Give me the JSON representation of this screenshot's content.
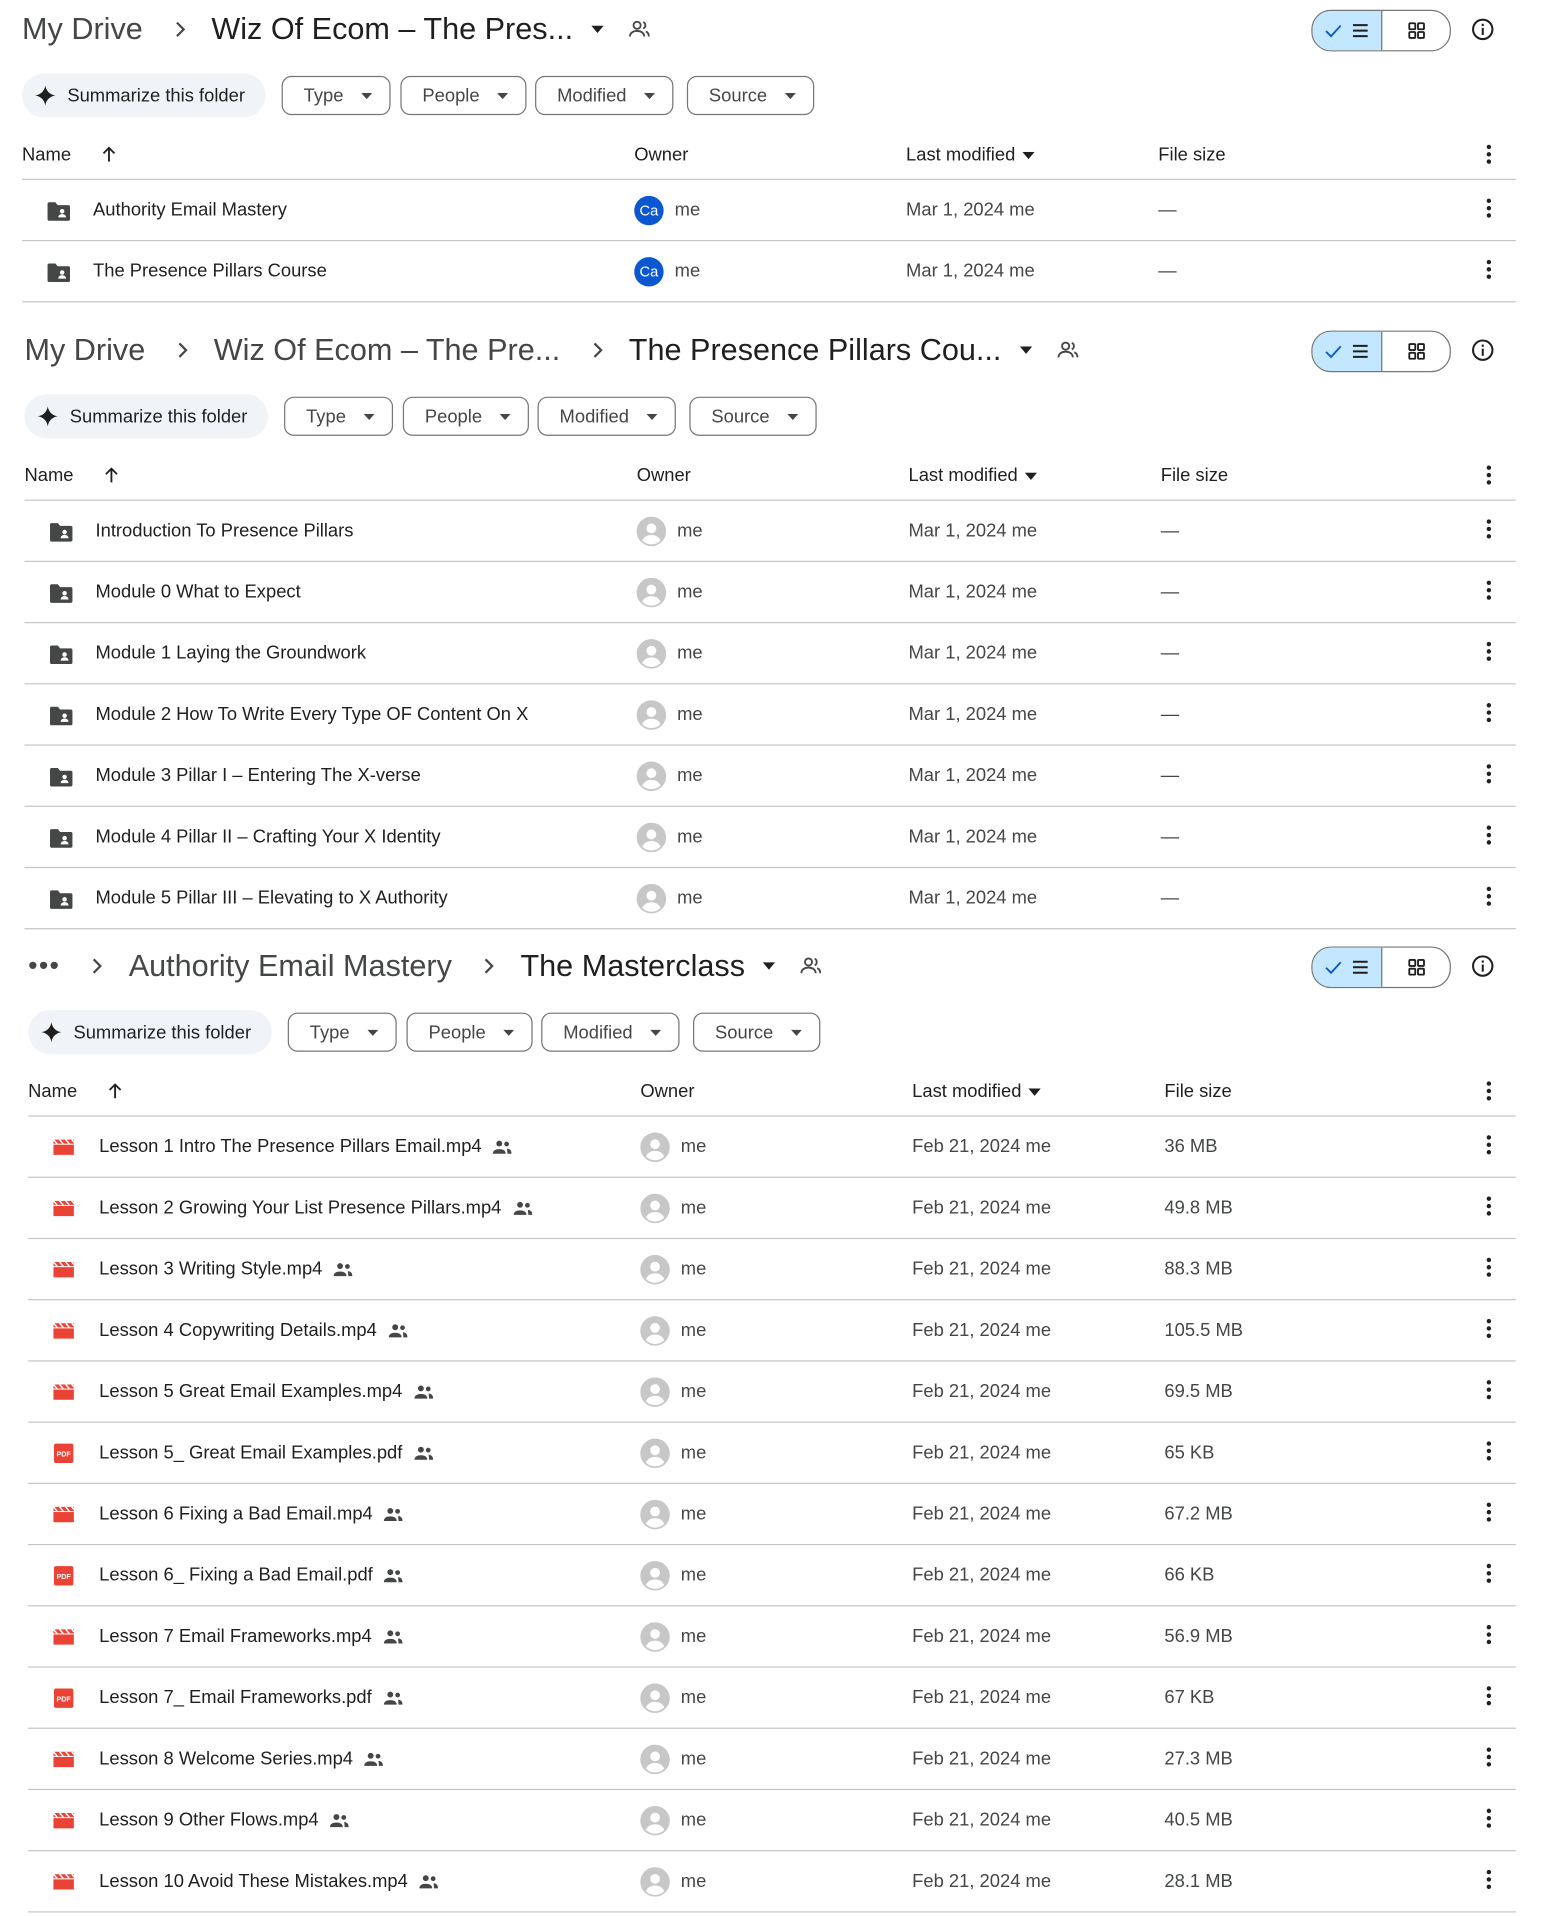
{
  "panels": [
    {
      "breadcrumb": {
        "crumbs": [
          "My Drive"
        ],
        "current": "Wiz Of Ecom – The Pres..."
      },
      "summarize_label": "Summarize this folder",
      "filters": [
        "Type",
        "People",
        "Modified",
        "Source"
      ],
      "columns": {
        "name": "Name",
        "owner": "Owner",
        "modified": "Last modified",
        "size": "File size"
      },
      "rows": [
        {
          "type": "folder",
          "name": "Authority Email Mastery",
          "avatar": "Ca",
          "owner": "me",
          "modified": "Mar 1, 2024 me",
          "size": "—",
          "shared": false
        },
        {
          "type": "folder",
          "name": "The Presence Pillars Course",
          "avatar": "Ca",
          "owner": "me",
          "modified": "Mar 1, 2024 me",
          "size": "—",
          "shared": false
        }
      ]
    },
    {
      "breadcrumb": {
        "crumbs": [
          "My Drive",
          "Wiz Of Ecom – The Pre..."
        ],
        "current": "The Presence Pillars Cou..."
      },
      "summarize_label": "Summarize this folder",
      "filters": [
        "Type",
        "People",
        "Modified",
        "Source"
      ],
      "columns": {
        "name": "Name",
        "owner": "Owner",
        "modified": "Last modified",
        "size": "File size"
      },
      "rows": [
        {
          "type": "folder",
          "name": "Introduction To Presence Pillars",
          "avatar": "",
          "owner": "me",
          "modified": "Mar 1, 2024 me",
          "size": "—",
          "shared": false
        },
        {
          "type": "folder",
          "name": "Module 0 What to Expect",
          "avatar": "",
          "owner": "me",
          "modified": "Mar 1, 2024 me",
          "size": "—",
          "shared": false
        },
        {
          "type": "folder",
          "name": "Module 1 Laying the Groundwork",
          "avatar": "",
          "owner": "me",
          "modified": "Mar 1, 2024 me",
          "size": "—",
          "shared": false
        },
        {
          "type": "folder",
          "name": "Module 2 How To Write Every Type OF Content On X",
          "avatar": "",
          "owner": "me",
          "modified": "Mar 1, 2024 me",
          "size": "—",
          "shared": false
        },
        {
          "type": "folder",
          "name": "Module 3 Pillar I – Entering The X-verse",
          "avatar": "",
          "owner": "me",
          "modified": "Mar 1, 2024 me",
          "size": "—",
          "shared": false
        },
        {
          "type": "folder",
          "name": "Module 4 Pillar II – Crafting Your X Identity",
          "avatar": "",
          "owner": "me",
          "modified": "Mar 1, 2024 me",
          "size": "—",
          "shared": false
        },
        {
          "type": "folder",
          "name": "Module 5 Pillar III – Elevating to X Authority",
          "avatar": "",
          "owner": "me",
          "modified": "Mar 1, 2024 me",
          "size": "—",
          "shared": false
        }
      ]
    },
    {
      "breadcrumb": {
        "overflow": "•••",
        "crumbs": [
          "Authority Email Mastery"
        ],
        "current": "The Masterclass"
      },
      "summarize_label": "Summarize this folder",
      "filters": [
        "Type",
        "People",
        "Modified",
        "Source"
      ],
      "columns": {
        "name": "Name",
        "owner": "Owner",
        "modified": "Last modified",
        "size": "File size"
      },
      "rows": [
        {
          "type": "video",
          "name": "Lesson 1 Intro The Presence Pillars Email.mp4",
          "avatar": "",
          "owner": "me",
          "modified": "Feb 21, 2024 me",
          "size": "36 MB",
          "shared": true
        },
        {
          "type": "video",
          "name": "Lesson 2 Growing Your List Presence Pillars.mp4",
          "avatar": "",
          "owner": "me",
          "modified": "Feb 21, 2024 me",
          "size": "49.8 MB",
          "shared": true
        },
        {
          "type": "video",
          "name": "Lesson 3 Writing Style.mp4",
          "avatar": "",
          "owner": "me",
          "modified": "Feb 21, 2024 me",
          "size": "88.3 MB",
          "shared": true
        },
        {
          "type": "video",
          "name": "Lesson 4 Copywriting Details.mp4",
          "avatar": "",
          "owner": "me",
          "modified": "Feb 21, 2024 me",
          "size": "105.5 MB",
          "shared": true
        },
        {
          "type": "video",
          "name": "Lesson 5 Great Email Examples.mp4",
          "avatar": "",
          "owner": "me",
          "modified": "Feb 21, 2024 me",
          "size": "69.5 MB",
          "shared": true
        },
        {
          "type": "pdf",
          "name": "Lesson 5_ Great Email Examples.pdf",
          "avatar": "",
          "owner": "me",
          "modified": "Feb 21, 2024 me",
          "size": "65 KB",
          "shared": true
        },
        {
          "type": "video",
          "name": "Lesson 6 Fixing a Bad Email.mp4",
          "avatar": "",
          "owner": "me",
          "modified": "Feb 21, 2024 me",
          "size": "67.2 MB",
          "shared": true
        },
        {
          "type": "pdf",
          "name": "Lesson 6_ Fixing a Bad Email.pdf",
          "avatar": "",
          "owner": "me",
          "modified": "Feb 21, 2024 me",
          "size": "66 KB",
          "shared": true
        },
        {
          "type": "video",
          "name": "Lesson 7 Email Frameworks.mp4",
          "avatar": "",
          "owner": "me",
          "modified": "Feb 21, 2024 me",
          "size": "56.9 MB",
          "shared": true
        },
        {
          "type": "pdf",
          "name": "Lesson 7_ Email Frameworks.pdf",
          "avatar": "",
          "owner": "me",
          "modified": "Feb 21, 2024 me",
          "size": "67 KB",
          "shared": true
        },
        {
          "type": "video",
          "name": "Lesson 8 Welcome Series.mp4",
          "avatar": "",
          "owner": "me",
          "modified": "Feb 21, 2024 me",
          "size": "27.3 MB",
          "shared": true
        },
        {
          "type": "video",
          "name": "Lesson 9 Other Flows.mp4",
          "avatar": "",
          "owner": "me",
          "modified": "Feb 21, 2024 me",
          "size": "40.5 MB",
          "shared": true
        },
        {
          "type": "video",
          "name": "Lesson 10 Avoid These Mistakes.mp4",
          "avatar": "",
          "owner": "me",
          "modified": "Feb 21, 2024 me",
          "size": "28.1 MB",
          "shared": true
        }
      ]
    }
  ],
  "icons": {
    "folder": "shared-folder-icon",
    "video": "video-file-icon",
    "pdf": "pdf-file-icon",
    "shared": "shared-people-icon",
    "view_list": "list-view-icon",
    "view_grid": "grid-view-icon",
    "info": "info-icon",
    "sparkle": "sparkle-icon",
    "more": "more-vert-icon"
  },
  "colors": {
    "accent": "#0b57d0",
    "toggle_active": "#c2e7ff",
    "video": "#ea4335",
    "pdf": "#ea4335",
    "folder": "#444746",
    "divider": "#c4c7c5"
  }
}
